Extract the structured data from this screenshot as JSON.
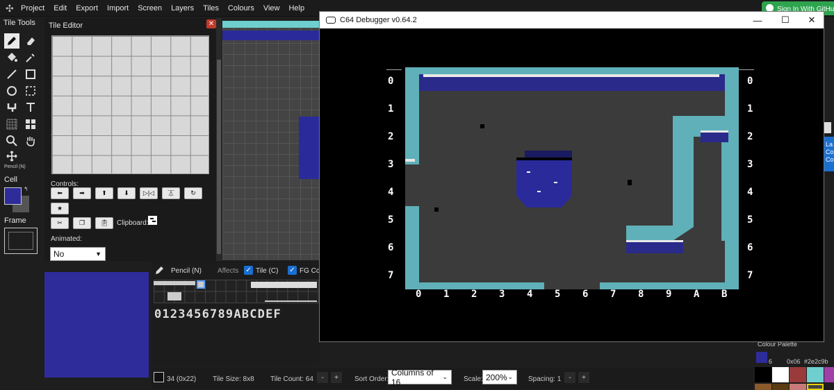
{
  "menubar": {
    "items": [
      "Project",
      "Edit",
      "Export",
      "Import",
      "Screen",
      "Layers",
      "Tiles",
      "Colours",
      "View",
      "Help"
    ],
    "github": "Sign In With GitHub"
  },
  "tile_tools": {
    "title": "Tile Tools",
    "current_tool": "Pencil (N)",
    "cell_label": "Cell",
    "frame_label": "Frame"
  },
  "tile_editor": {
    "title": "Tile Editor",
    "controls_label": "Controls:",
    "clipboard_label": "Clipboard:",
    "animated_label": "Animated:",
    "animated_value": "No"
  },
  "tileset_bar": {
    "tool_label": "Pencil (N)",
    "affects_label": "Affects",
    "tile_check": "Tile (C)",
    "fg_check": "FG Co",
    "hex_digits": "0123456789ABCDEF"
  },
  "status": {
    "selected_tile": "34 (0x22)",
    "tile_size": "Tile Size:  8x8",
    "tile_count": "Tile Count: 64",
    "sort_order_label": "Sort Order:",
    "sort_order_value": "Columns of 16",
    "scale_label": "Scale:",
    "scale_value": "200%",
    "spacing": "Spacing: 1"
  },
  "debugger": {
    "title": "C64 Debugger v0.64.2",
    "rows": [
      "0",
      "1",
      "2",
      "3",
      "4",
      "5",
      "6",
      "7"
    ],
    "cols": [
      "0",
      "1",
      "2",
      "3",
      "4",
      "5",
      "6",
      "7",
      "8",
      "9",
      "A",
      "B"
    ]
  },
  "palette": {
    "title": "Colour Palette",
    "index": "6",
    "hex": "0x06",
    "color": "#2e2c9b",
    "colors": [
      "#000000",
      "#ffffff",
      "#9a3b3b",
      "#6fcfcf",
      "#a03fa8",
      "#1d1d1d",
      "#2e2c9b",
      "#c0c0c0"
    ]
  },
  "right_edge": {
    "la": "La",
    "co": "Co",
    "c2": "Co"
  },
  "colors": {
    "accent": "#2e2c9b",
    "teal": "#5fb0b8",
    "floor": "#3b3b3b"
  }
}
